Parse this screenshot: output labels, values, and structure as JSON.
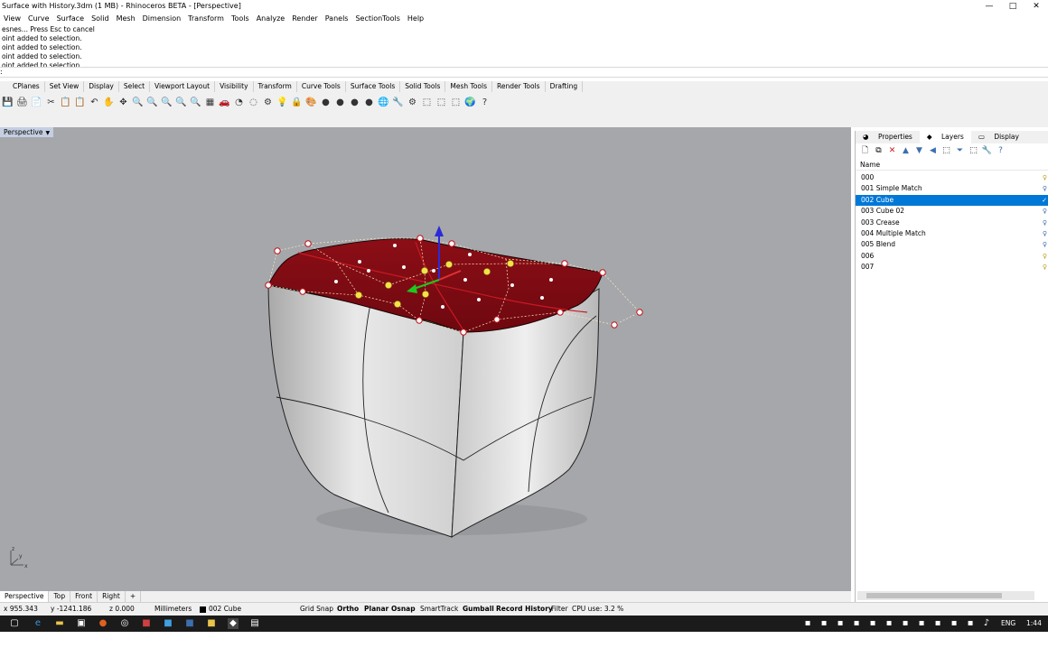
{
  "window": {
    "title": "Surface with History.3dm (1 MB) - Rhinoceros BETA - [Perspective]",
    "buttons": [
      "—",
      "□",
      "✕"
    ]
  },
  "menu": [
    "View",
    "Curve",
    "Surface",
    "Solid",
    "Mesh",
    "Dimension",
    "Transform",
    "Tools",
    "Analyze",
    "Render",
    "Panels",
    "SectionTools",
    "Help"
  ],
  "command_history": [
    "esnes... Press Esc to cancel",
    "oint added to selection.",
    "oint added to selection.",
    "oint added to selection.",
    "oint added to selection."
  ],
  "command_prompt": ":",
  "toolbar_tabs": [
    "CPlanes",
    "Set View",
    "Display",
    "Select",
    "Viewport Layout",
    "Visibility",
    "Transform",
    "Curve Tools",
    "Surface Tools",
    "Solid Tools",
    "Mesh Tools",
    "Render Tools",
    "Drafting"
  ],
  "toolbar_icons": [
    "💾",
    "🖨",
    "📄",
    "✂",
    "📋",
    "📋",
    "↶",
    "✋",
    "✥",
    "🔍",
    "🔍",
    "🔍",
    "🔍",
    "🔍",
    "▦",
    "🚗",
    "◔",
    "◌",
    "⚙",
    "💡",
    "🔒",
    "🎨",
    "●",
    "●",
    "●",
    "●",
    "🌐",
    "🔧",
    "⚙",
    "⬚",
    "⬚",
    "⬚",
    "🌍",
    "?"
  ],
  "viewport": {
    "label": "Perspective",
    "caret": "▼"
  },
  "axes": {
    "x": "x",
    "y": "y",
    "z": "z"
  },
  "panel": {
    "tabs": [
      "Properties",
      "Layers",
      "Display"
    ],
    "active_tab": "Layers",
    "tool_icons": [
      "🗋",
      "⧉",
      "✕",
      "▲",
      "▼",
      "◀",
      "⬚",
      "⏷",
      "⬚",
      "🔧",
      "?"
    ],
    "column_header": "Name",
    "layers": [
      {
        "name": "000",
        "selected": false
      },
      {
        "name": "001 Simple Match",
        "selected": false
      },
      {
        "name": "002 Cube",
        "selected": true
      },
      {
        "name": "003 Cube 02",
        "selected": false
      },
      {
        "name": "003 Crease",
        "selected": false
      },
      {
        "name": "004 Multiple Match",
        "selected": false
      },
      {
        "name": "005 Blend",
        "selected": false
      },
      {
        "name": "006",
        "selected": false
      },
      {
        "name": "007",
        "selected": false
      }
    ],
    "current_mark": "✓"
  },
  "view_tabs": [
    "Perspective",
    "Top",
    "Front",
    "Right",
    "+"
  ],
  "status": {
    "x": "x 955.343",
    "y": "y -1241.186",
    "z": "z 0.000",
    "units": "Millimeters",
    "layer": "002 Cube",
    "grid_snap": "Grid Snap",
    "ortho": "Ortho",
    "planar": "Planar",
    "osnap": "Osnap",
    "smarttrack": "SmartTrack",
    "gumball": "Gumball",
    "record_history": "Record History",
    "filter": "Filter",
    "cpu": "CPU use: 3.2 %"
  },
  "taskbar": {
    "lang": "ENG",
    "time": "1:44 PM"
  },
  "colors": {
    "viewport_bg": "#a5a7ab",
    "surface_red": "#7d0a12",
    "selection_blue": "#0078d7"
  }
}
